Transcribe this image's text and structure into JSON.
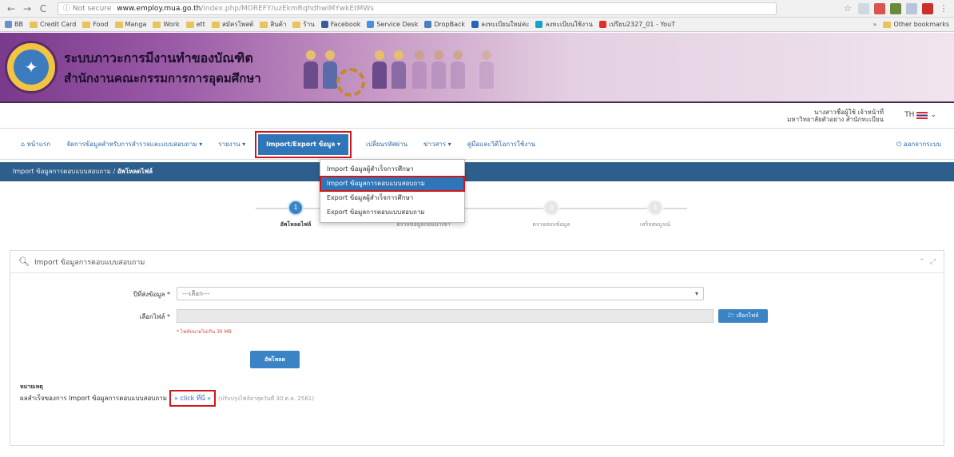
{
  "browser": {
    "nav_back": "←",
    "nav_forward": "→",
    "nav_reload": "C",
    "not_secure": "ⓘ Not secure",
    "domain": "www.employ.mua.go.th",
    "path": "/index.php/MOREFY/uzEkmRqhdhwiMYwkEtMWs",
    "bookmarks": [
      "BB",
      "Credit Card",
      "Food",
      "Manga",
      "Work",
      "ett",
      "สมัครโพสต์",
      "สินค้า",
      "ร้าน",
      "Facebook",
      "Service Desk",
      "DropBack",
      "ลงทะเบียนใหม่ค่ะ",
      "ลงทะเบียนใช้งาน",
      "เปรียบ2327_01 - YouT"
    ],
    "other_bookmarks": "Other bookmarks"
  },
  "site": {
    "title_line1": "ระบบภาวะการมีงานทำของบัณฑิต",
    "title_line2": "สำนักงานคณะกรรมการการอุดมศึกษา",
    "user_line1": "นางสาวชื่อผู้ใช้ เจ้าหน้าที่",
    "user_line2": "มหาวิทยาลัยตัวอย่าง สำนักทะเบียน",
    "lang": "TH"
  },
  "menu": {
    "home": "หน้าแรก",
    "manage": "จัดการข้อมูลสำหรับการสำรวจและแบบสอบถาม",
    "report": "รายงาน",
    "import_export": "Import/Export ข้อมูล",
    "change_password": "เปลี่ยนรหัสผ่าน",
    "news": "ข่าวสาร",
    "manual": "คู่มือและวิดีโอการใช้งาน",
    "logout": "ออกจากระบบ"
  },
  "dropdown": {
    "items": [
      "Import ข้อมูลผู้สำเร็จการศึกษา",
      "Import ข้อมูลการตอบแบบสอบถาม",
      "Export ข้อมูลผู้สำเร็จการศึกษา",
      "Export ข้อมูลการตอบแบบสอบถาม"
    ]
  },
  "breadcrumb": {
    "parent": "Import ข้อมูลการตอบแบบสอบถาม",
    "current": "อัพโหลดไฟล์"
  },
  "steps": [
    {
      "num": "1",
      "label": "อัพโหลดไฟล์"
    },
    {
      "num": "2",
      "label": "ตรวจข้อมูลก่อนนำเข้า"
    },
    {
      "num": "3",
      "label": "ตรวจสอบข้อมูล"
    },
    {
      "num": "4",
      "label": "เสร็จสมบูรณ์"
    }
  ],
  "panel": {
    "title": "Import ข้อมูลการตอบแบบสอบถาม",
    "type_label": "ปีที่ส่งข้อมูล",
    "type_value": "---เลือก---",
    "file_label": "เลือกไฟล์",
    "browse": "เลือกไฟล์",
    "hint": "* ไฟล์ขนาดไม่เกิน 30 MB",
    "submit": "อัพโหลด",
    "note_title": "หมายเหตุ",
    "note_text": "ผลสำเร็จของการ Import ข้อมูลการตอบแบบสอบถาม",
    "click_here": "» click ที่นี่ «",
    "note_suffix": "(ปรับปรุงไฟล์ล่าสุดวันที่ 30 ต.ค. 2561)"
  },
  "colors": {
    "primary": "#2f75b7",
    "crumb": "#2e5f8c",
    "highlight": "#d01717"
  }
}
